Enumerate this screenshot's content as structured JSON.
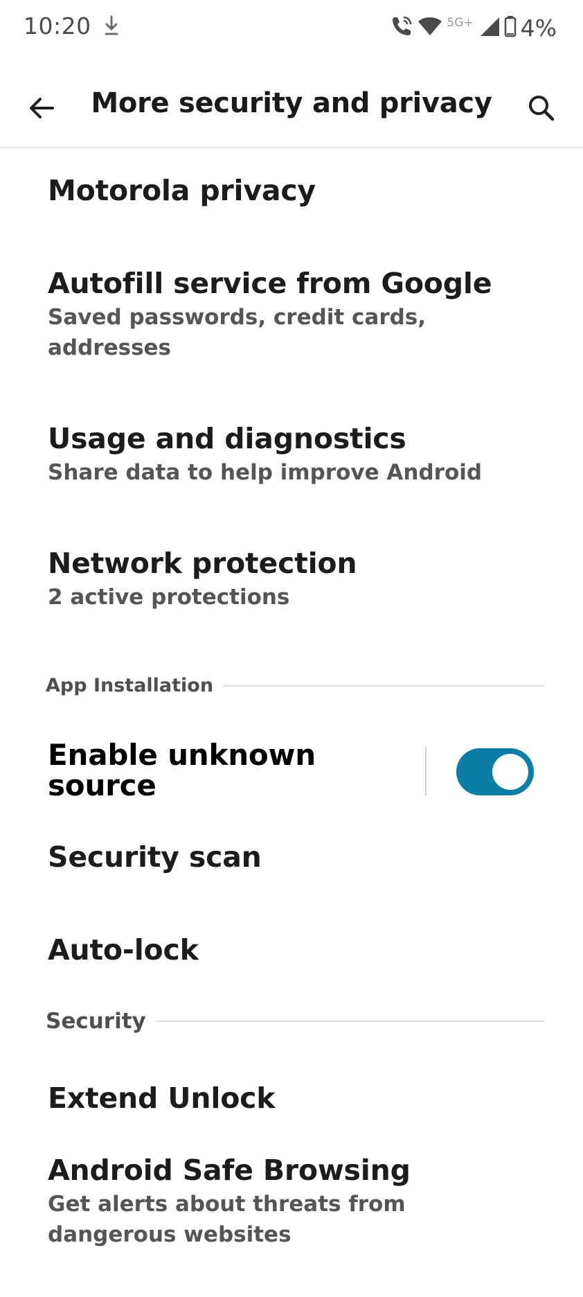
{
  "status_bar": {
    "time": "10:20",
    "network": "5G+",
    "battery": "4%",
    "icons": [
      "download-icon",
      "wifi-calling-icon",
      "wifi-icon",
      "signal-icon",
      "battery-icon"
    ]
  },
  "app_bar": {
    "title": "More security and privacy",
    "back_icon": "arrow-back-icon",
    "search_icon": "search-icon"
  },
  "items": [
    {
      "title": "Motorola privacy"
    },
    {
      "title": "Autofill service from Google",
      "subtitle_line1": "Saved passwords, credit cards,",
      "subtitle_line2": "addresses"
    },
    {
      "title": "Usage and diagnostics",
      "subtitle": "Share data to help improve Android"
    },
    {
      "title": "Network protection",
      "subtitle": "2 active protections"
    }
  ],
  "app_installation": {
    "header": "App Installation",
    "unknown_source_line1": "Enable unknown",
    "unknown_source_line2": "source",
    "unknown_source_enabled": true,
    "security_scan": "Security scan",
    "auto_lock": "Auto-lock"
  },
  "security": {
    "header": "Security",
    "extend_unlock": "Extend Unlock",
    "safe_browsing_title": "Android Safe Browsing",
    "safe_browsing_sub_line1": "Get alerts about threats from",
    "safe_browsing_sub_line2": "dangerous websites"
  },
  "colors": {
    "accent": "#0a7ea4",
    "text": "#1c1c1c",
    "secondary": "#555555"
  }
}
